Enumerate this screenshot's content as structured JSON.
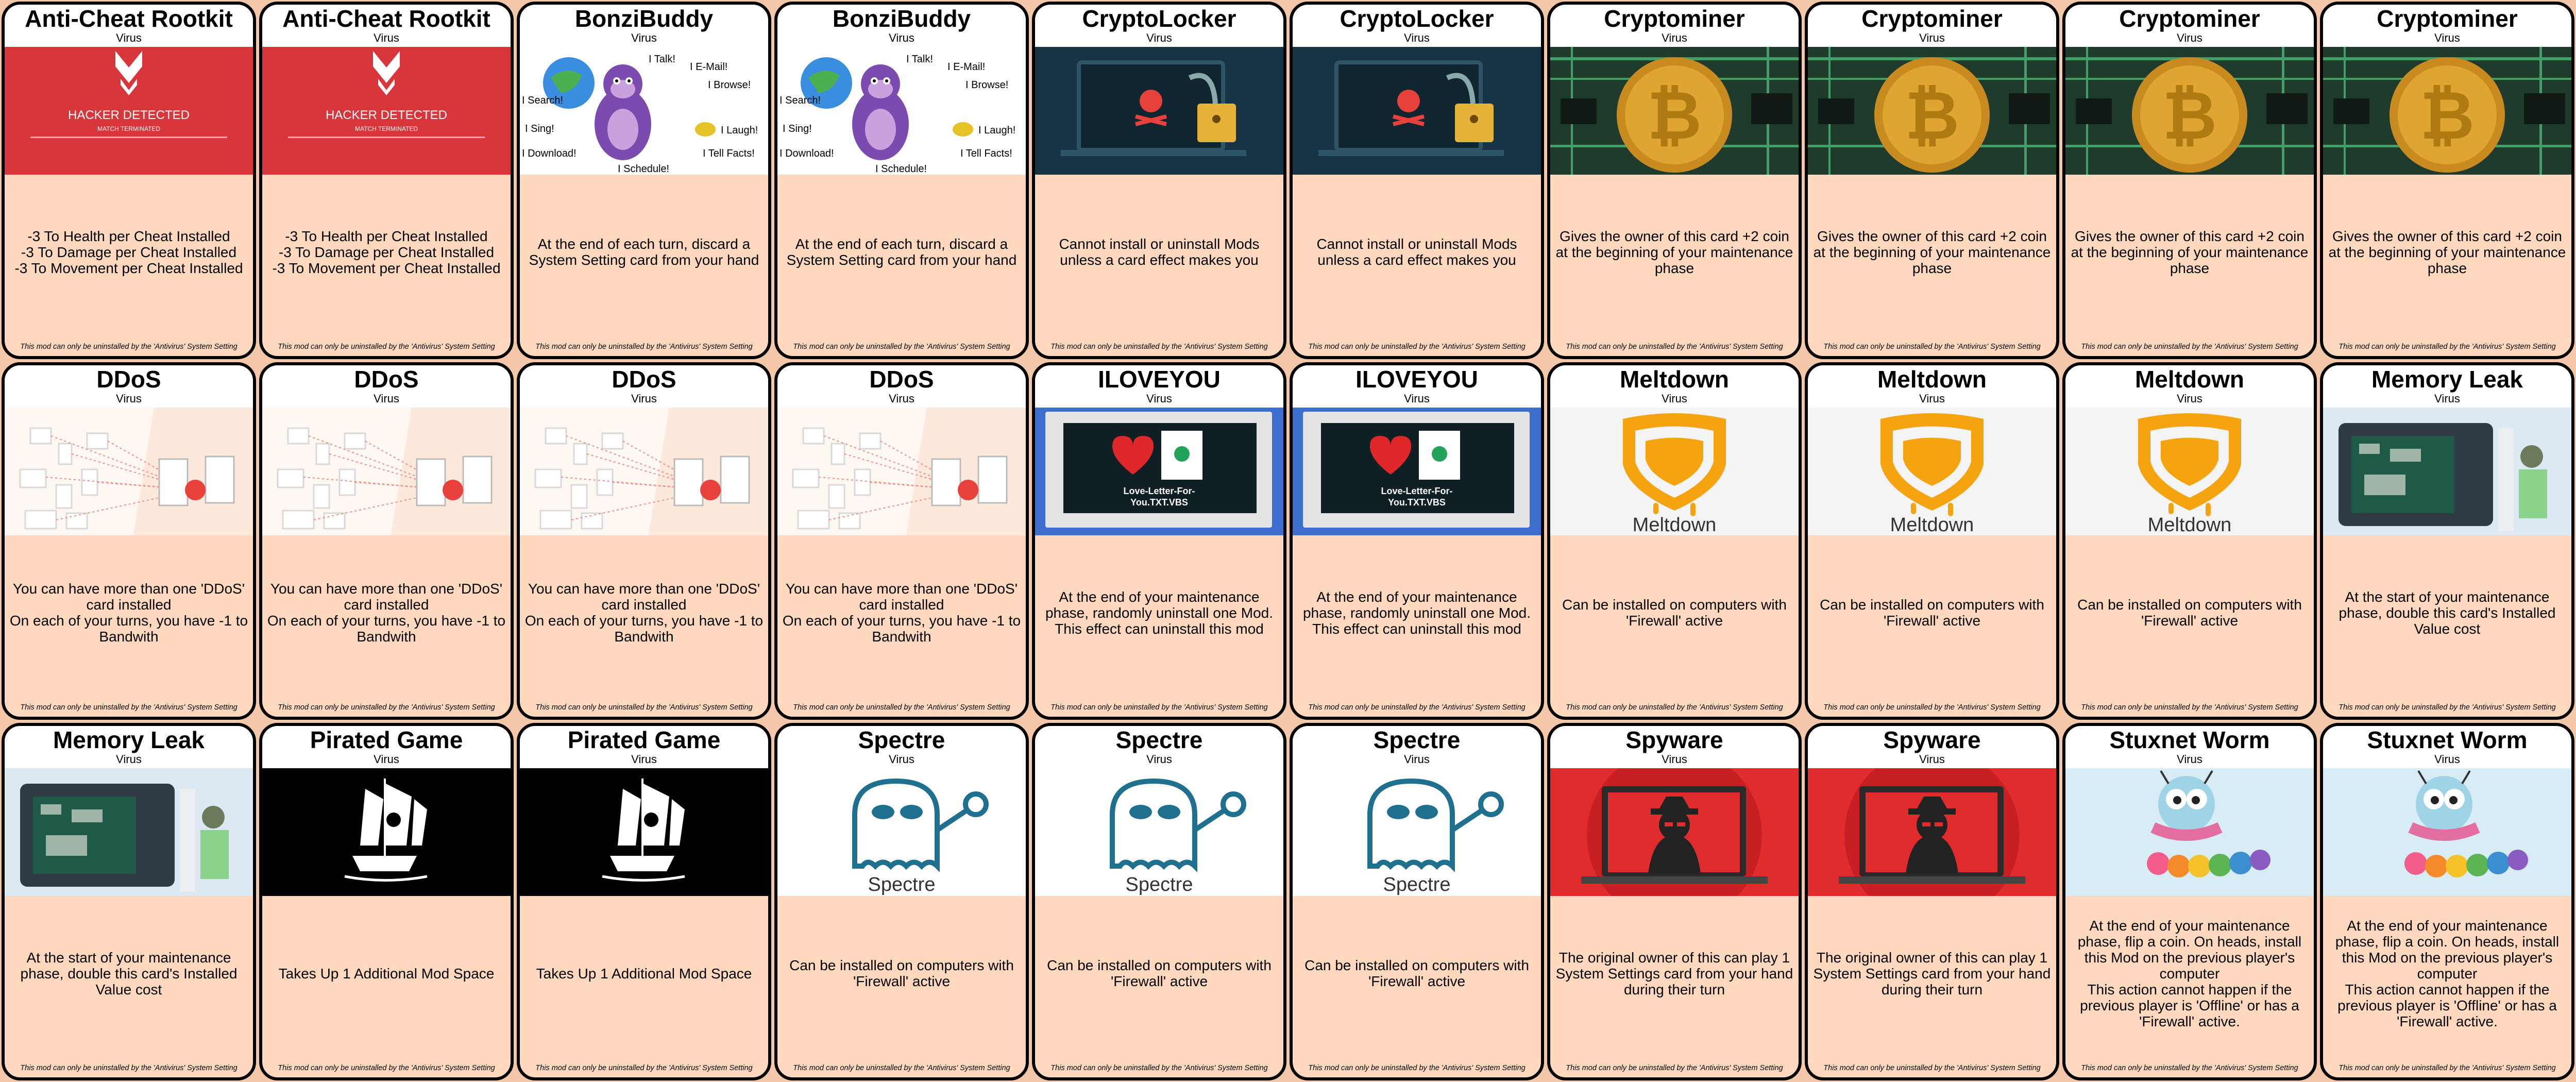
{
  "footer": "This mod can only be uninstalled by the 'Antivirus' System Setting",
  "cards": [
    {
      "name": "Anti-Cheat Rootkit",
      "type": "Virus",
      "art": "rootkit",
      "art_text": [
        "HACKER DETECTED",
        "MATCH TERMINATED"
      ],
      "desc": "-3 To Health per Cheat Installed\n-3 To Damage per Cheat Installed\n-3 To Movement per Cheat Installed"
    },
    {
      "name": "Anti-Cheat Rootkit",
      "type": "Virus",
      "art": "rootkit",
      "art_text": [
        "HACKER DETECTED",
        "MATCH TERMINATED"
      ],
      "desc": "-3 To Health per Cheat Installed\n-3 To Damage per Cheat Installed\n-3 To Movement per Cheat Installed"
    },
    {
      "name": "BonziBuddy",
      "type": "Virus",
      "art": "bonzi",
      "art_text": [
        "I Talk!",
        "I E-Mail!",
        "I Browse!",
        "I Search!",
        "I Sing!",
        "I Laugh!",
        "I Download!",
        "I Tell Facts!",
        "I Schedule!"
      ],
      "desc": "At the end of each turn, discard a System Setting card from your hand"
    },
    {
      "name": "BonziBuddy",
      "type": "Virus",
      "art": "bonzi",
      "art_text": [
        "I Talk!",
        "I E-Mail!",
        "I Browse!",
        "I Search!",
        "I Sing!",
        "I Laugh!",
        "I Download!",
        "I Tell Facts!",
        "I Schedule!"
      ],
      "desc": "At the end of each turn, discard a System Setting card from your hand"
    },
    {
      "name": "CryptoLocker",
      "type": "Virus",
      "art": "crypto",
      "desc": "Cannot install or uninstall Mods unless a card effect makes you"
    },
    {
      "name": "CryptoLocker",
      "type": "Virus",
      "art": "crypto",
      "desc": "Cannot install or uninstall Mods unless a card effect makes you"
    },
    {
      "name": "Cryptominer",
      "type": "Virus",
      "art": "miner",
      "desc": "Gives the owner of this card +2 coin at the beginning of your maintenance phase"
    },
    {
      "name": "Cryptominer",
      "type": "Virus",
      "art": "miner",
      "desc": "Gives the owner of this card +2 coin at the beginning of your maintenance phase"
    },
    {
      "name": "Cryptominer",
      "type": "Virus",
      "art": "miner",
      "desc": "Gives the owner of this card +2 coin at the beginning of your maintenance phase"
    },
    {
      "name": "Cryptominer",
      "type": "Virus",
      "art": "miner",
      "desc": "Gives the owner of this card +2 coin at the beginning of your maintenance phase"
    },
    {
      "name": "DDoS",
      "type": "Virus",
      "art": "ddos",
      "desc": "You can have more than one 'DDoS' card installed\nOn each of your turns, you have -1 to Bandwith"
    },
    {
      "name": "DDoS",
      "type": "Virus",
      "art": "ddos",
      "desc": "You can have more than one 'DDoS' card installed\nOn each of your turns, you have -1 to Bandwith"
    },
    {
      "name": "DDoS",
      "type": "Virus",
      "art": "ddos",
      "desc": "You can have more than one 'DDoS' card installed\nOn each of your turns, you have -1 to Bandwith"
    },
    {
      "name": "DDoS",
      "type": "Virus",
      "art": "ddos",
      "desc": "You can have more than one 'DDoS' card installed\nOn each of your turns, you have -1 to Bandwith"
    },
    {
      "name": "ILOVEYOU",
      "type": "Virus",
      "art": "iloveyou",
      "art_text": [
        "Love-Letter-For-",
        "You.TXT.VBS"
      ],
      "desc": "At the end of your maintenance phase, randomly uninstall one Mod. This effect can uninstall this mod"
    },
    {
      "name": "ILOVEYOU",
      "type": "Virus",
      "art": "iloveyou",
      "art_text": [
        "Love-Letter-For-",
        "You.TXT.VBS"
      ],
      "desc": "At the end of your maintenance phase, randomly uninstall one Mod. This effect can uninstall this mod"
    },
    {
      "name": "Meltdown",
      "type": "Virus",
      "art": "meltdown",
      "art_text": [
        "Meltdown"
      ],
      "desc": "Can be installed on computers with 'Firewall' active"
    },
    {
      "name": "Meltdown",
      "type": "Virus",
      "art": "meltdown",
      "art_text": [
        "Meltdown"
      ],
      "desc": "Can be installed on computers with 'Firewall' active"
    },
    {
      "name": "Meltdown",
      "type": "Virus",
      "art": "meltdown",
      "art_text": [
        "Meltdown"
      ],
      "desc": "Can be installed on computers with 'Firewall' active"
    },
    {
      "name": "Memory Leak",
      "type": "Virus",
      "art": "memleak",
      "desc": "At the start of your maintenance phase, double this card's Installed Value cost"
    },
    {
      "name": "Memory Leak",
      "type": "Virus",
      "art": "memleak",
      "desc": "At the start of your maintenance phase, double this card's Installed Value cost"
    },
    {
      "name": "Pirated Game",
      "type": "Virus",
      "art": "pirate",
      "desc": "Takes Up 1 Additional Mod Space"
    },
    {
      "name": "Pirated Game",
      "type": "Virus",
      "art": "pirate",
      "desc": "Takes Up 1 Additional Mod Space"
    },
    {
      "name": "Spectre",
      "type": "Virus",
      "art": "spectre",
      "art_text": [
        "Spectre"
      ],
      "desc": "Can be installed on computers with 'Firewall' active"
    },
    {
      "name": "Spectre",
      "type": "Virus",
      "art": "spectre",
      "art_text": [
        "Spectre"
      ],
      "desc": "Can be installed on computers with 'Firewall' active"
    },
    {
      "name": "Spectre",
      "type": "Virus",
      "art": "spectre",
      "art_text": [
        "Spectre"
      ],
      "desc": "Can be installed on computers with 'Firewall' active"
    },
    {
      "name": "Spyware",
      "type": "Virus",
      "art": "spyware",
      "desc": "The original owner of this can play 1 System Settings card from your hand during their turn"
    },
    {
      "name": "Spyware",
      "type": "Virus",
      "art": "spyware",
      "desc": "The original owner of this can play 1 System Settings card from your hand during their turn"
    },
    {
      "name": "Stuxnet Worm",
      "type": "Virus",
      "art": "worm",
      "desc": "At the end of your maintenance phase, flip a coin. On heads, install this Mod on the previous player's computer\nThis action cannot happen if the previous player is 'Offline' or has a 'Firewall' active."
    },
    {
      "name": "Stuxnet Worm",
      "type": "Virus",
      "art": "worm",
      "desc": "At the end of your maintenance phase, flip a coin. On heads, install this Mod on the previous player's computer\nThis action cannot happen if the previous player is 'Offline' or has a 'Firewall' active."
    }
  ]
}
